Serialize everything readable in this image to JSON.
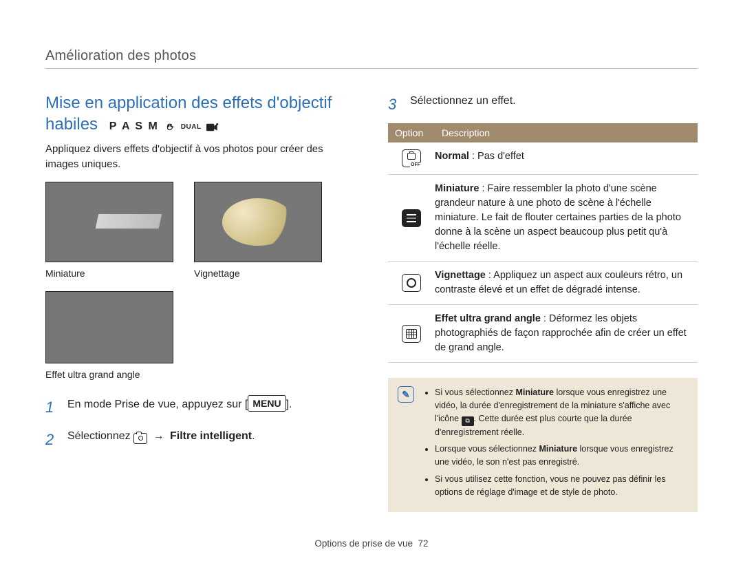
{
  "breadcrumb": "Amélioration des photos",
  "section_title_line1": "Mise en application des effets d'objectif",
  "section_title_line2": "habiles",
  "mode_letters": "P A S M",
  "mode_dual": "DUAL",
  "intro": "Appliquez divers effets d'objectif à vos photos pour créer des images uniques.",
  "thumbs": {
    "miniature": "Miniature",
    "vignette": "Vignettage",
    "wide": "Effet ultra grand angle"
  },
  "steps": {
    "s1_num": "1",
    "s1_a": "En mode Prise de vue, appuyez sur [",
    "s1_menu": "MENU",
    "s1_b": "].",
    "s2_num": "2",
    "s2_a": "Sélectionnez ",
    "s2_arrow": "→",
    "s2_bold": "Filtre intelligent",
    "s2_end": ".",
    "s3_num": "3",
    "s3_text": "Sélectionnez un effet."
  },
  "table": {
    "head_option": "Option",
    "head_desc": "Description",
    "rows": [
      {
        "label_bold": "Normal",
        "label_rest": " : Pas d'effet"
      },
      {
        "label_bold": "Miniature",
        "label_rest": " : Faire ressembler la photo d'une scène grandeur nature à une photo de scène à l'échelle miniature. Le fait de flouter certaines parties de la photo donne à la scène un aspect beaucoup plus petit qu'à l'échelle réelle."
      },
      {
        "label_bold": "Vignettage",
        "label_rest": " : Appliquez un aspect aux couleurs rétro, un contraste élevé et un effet de dégradé intense."
      },
      {
        "label_bold": "Effet ultra grand angle",
        "label_rest": " : Déformez les objets photographiés de façon rapprochée afin de créer un effet de grand angle."
      }
    ]
  },
  "notes": {
    "n1_a": "Si vous sélectionnez ",
    "n1_bold": "Miniature",
    "n1_b": " lorsque vous enregistrez une vidéo, la durée d'enregistrement de la miniature s'affiche avec l'icône ",
    "n1_c": ". Cette durée est plus courte que la durée d'enregistrement réelle.",
    "n2_a": "Lorsque vous sélectionnez ",
    "n2_bold": "Miniature",
    "n2_b": " lorsque vous enregistrez une vidéo, le son n'est pas enregistré.",
    "n3": "Si vous utilisez cette fonction, vous ne pouvez pas définir les options de réglage d'image et de style de photo."
  },
  "footer_section": "Options de prise de vue",
  "footer_page": "72"
}
